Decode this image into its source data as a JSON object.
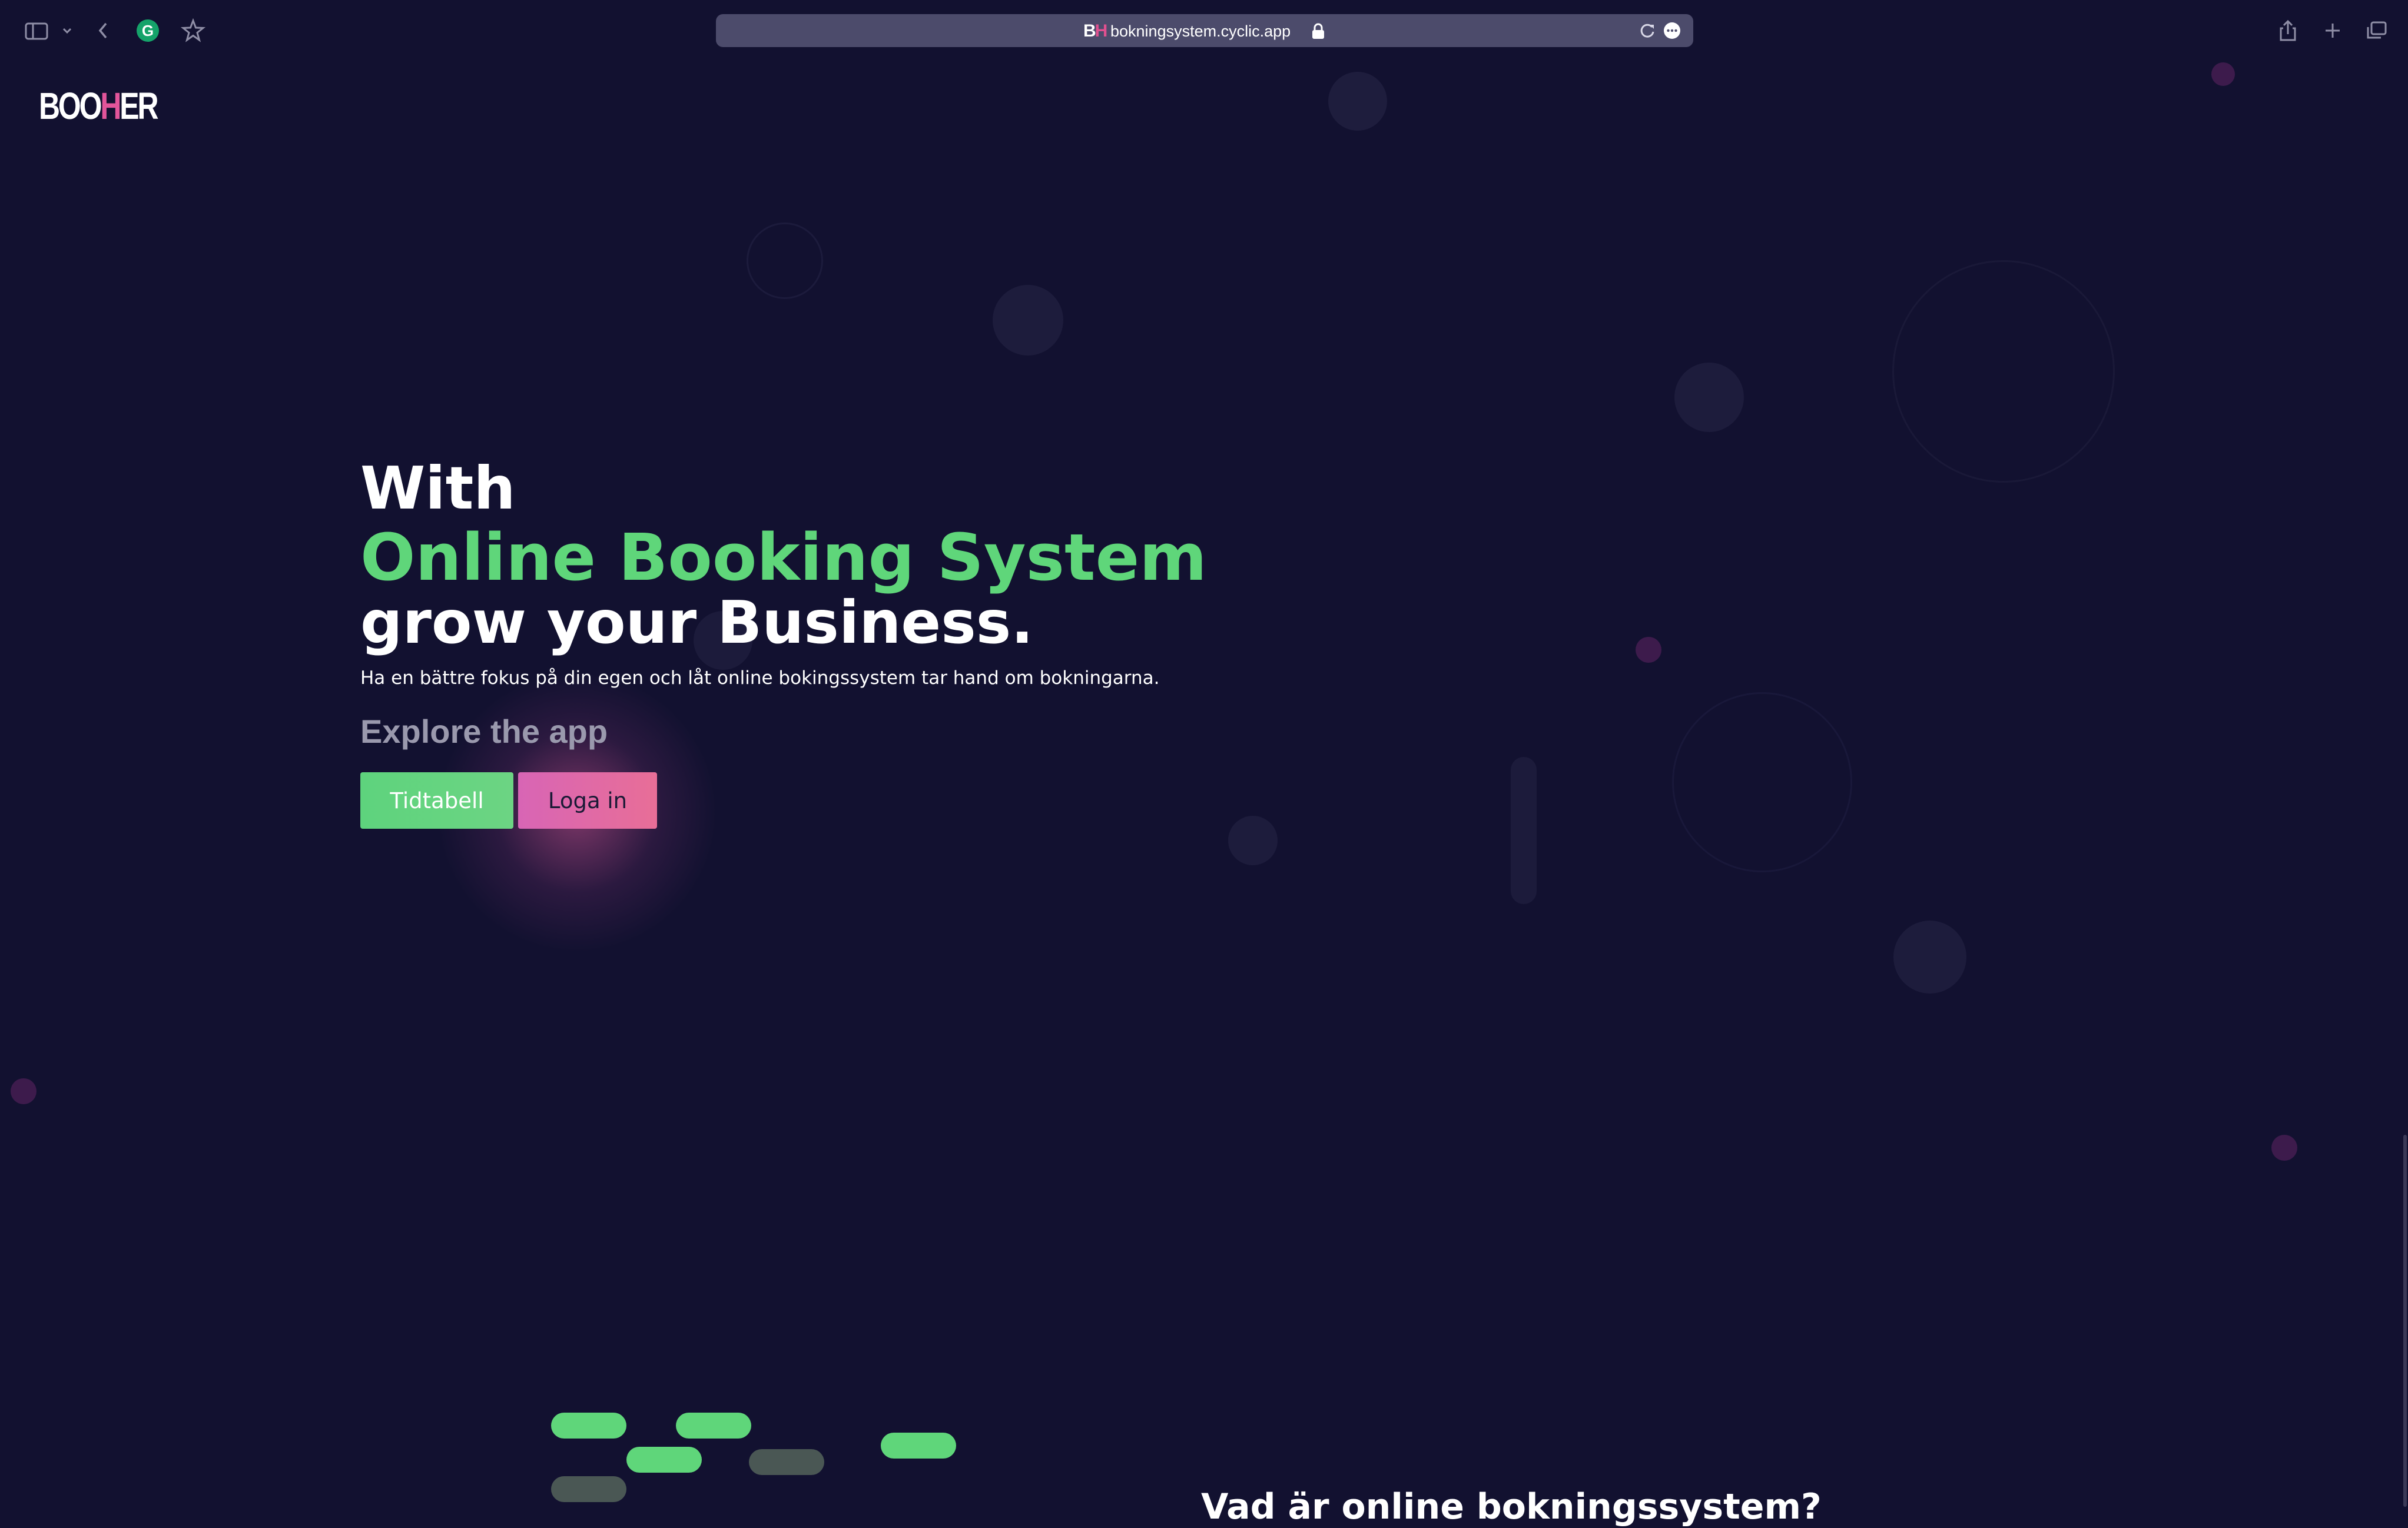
{
  "browser": {
    "url": "bokningsystem.cyclic.app",
    "favicon": {
      "letter_main": "B",
      "letter_accent": "H"
    },
    "icons": {
      "sidebar": "sidebar-icon",
      "chevron": "chevron-down-icon",
      "back": "back-arrow-icon",
      "extension": "grammarly-icon",
      "bookmark": "star-icon",
      "lock": "lock-icon",
      "reload": "reload-icon",
      "more": "more-icon",
      "share": "share-icon",
      "new_tab": "plus-icon",
      "tabs": "tabs-overview-icon"
    }
  },
  "page": {
    "logo": {
      "part1": "BOO",
      "accent": "H",
      "part2": "ER"
    },
    "hero": {
      "line1": "With",
      "line2": "Online Booking System",
      "line3": "grow your Business.",
      "subtitle": "Ha en bättre fokus på din egen och låt online bokingssystem tar hand om bokningarna.",
      "explore": "Explore the app",
      "primary_button": "Tidtabell",
      "secondary_button": "Loga in"
    },
    "next_section_heading": "Vad är online bokningssystem?"
  },
  "colors": {
    "background": "#121130",
    "accent_green": "#5fd67a",
    "accent_pink": "#e2559a",
    "muted_text": "#9a99ad"
  }
}
